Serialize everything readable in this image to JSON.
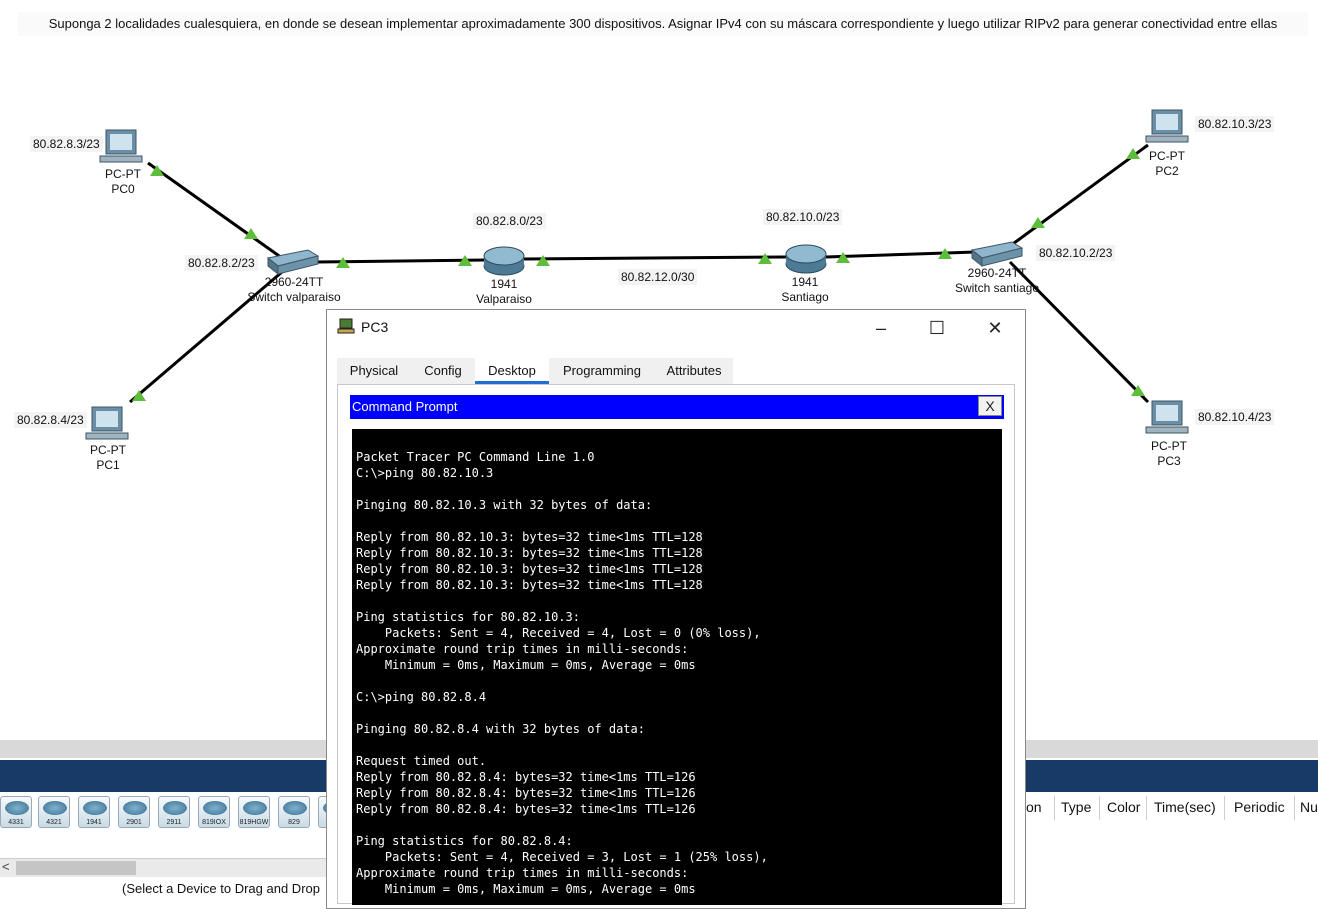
{
  "note": "Suponga 2 localidades cualesquiera, en donde se desean implementar aproximadamente 300 dispositivos. Asignar IPv4 con su máscara correspondiente y luego utilizar RIPv2 para generar conectividad entre ellas",
  "devices": {
    "pc0": {
      "type": "PC-PT",
      "name": "PC0",
      "ip": "80.82.8.3/23"
    },
    "pc1": {
      "type": "PC-PT",
      "name": "PC1",
      "ip": "80.82.8.4/23"
    },
    "pc2": {
      "type": "PC-PT",
      "name": "PC2",
      "ip": "80.82.10.3/23"
    },
    "pc3": {
      "type": "PC-PT",
      "name": "PC3",
      "ip": "80.82.10.4/23"
    },
    "sw_valpo": {
      "model": "2960-24TT",
      "name": "Switch valparaiso",
      "ip": "80.82.8.2/23"
    },
    "sw_stgo": {
      "model": "2960-24TT",
      "name": "Switch santiago",
      "ip": "80.82.10.2/23"
    },
    "r_valpo": {
      "model": "1941",
      "name": "Valparaiso",
      "net": "80.82.8.0/23"
    },
    "r_stgo": {
      "model": "1941",
      "name": "Santiago",
      "net": "80.82.10.0/23"
    },
    "wan": "80.82.12.0/30"
  },
  "window": {
    "title": "PC3",
    "tabs": [
      "Physical",
      "Config",
      "Desktop",
      "Programming",
      "Attributes"
    ],
    "active_tab": "Desktop",
    "cmd_title": "Command Prompt",
    "close_glyph": "X",
    "terminal": "Packet Tracer PC Command Line 1.0\nC:\\>ping 80.82.10.3\n\nPinging 80.82.10.3 with 32 bytes of data:\n\nReply from 80.82.10.3: bytes=32 time<1ms TTL=128\nReply from 80.82.10.3: bytes=32 time<1ms TTL=128\nReply from 80.82.10.3: bytes=32 time<1ms TTL=128\nReply from 80.82.10.3: bytes=32 time<1ms TTL=128\n\nPing statistics for 80.82.10.3:\n    Packets: Sent = 4, Received = 4, Lost = 0 (0% loss),\nApproximate round trip times in milli-seconds:\n    Minimum = 0ms, Maximum = 0ms, Average = 0ms\n\nC:\\>ping 80.82.8.4\n\nPinging 80.82.8.4 with 32 bytes of data:\n\nRequest timed out.\nReply from 80.82.8.4: bytes=32 time<1ms TTL=126\nReply from 80.82.8.4: bytes=32 time<1ms TTL=126\nReply from 80.82.8.4: bytes=32 time<1ms TTL=126\n\nPing statistics for 80.82.8.4:\n    Packets: Sent = 4, Received = 3, Lost = 1 (25% loss),\nApproximate round trip times in milli-seconds:\n    Minimum = 0ms, Maximum = 0ms, Average = 0ms"
  },
  "device_palette": [
    "4331",
    "4321",
    "1941",
    "2901",
    "2911",
    "819IOX",
    "819HGW",
    "829"
  ],
  "pdu_columns": [
    "on",
    "Type",
    "Color",
    "Time(sec)",
    "Periodic",
    "Nu"
  ],
  "status": "(Select a Device to Drag and Drop",
  "colors": {
    "link_up": "#5fbd3c",
    "cmd_bar": "#0000ff",
    "navy": "#183a66"
  }
}
